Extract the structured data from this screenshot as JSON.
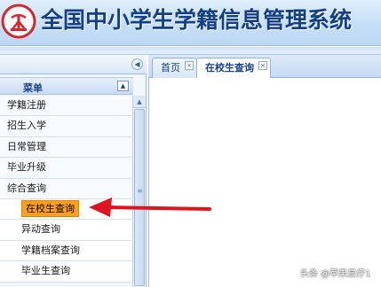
{
  "app": {
    "title": "全国中小学生学籍信息管理系统",
    "logo_icon": "school-logo-icon"
  },
  "sidebar": {
    "collapse_icon": "collapse-left-icon",
    "menu_header": "菜单",
    "menu_header_icon": "collapse-up-icon",
    "items": [
      {
        "label": "学籍注册",
        "level": 1
      },
      {
        "label": "招生入学",
        "level": 1
      },
      {
        "label": "日常管理",
        "level": 1
      },
      {
        "label": "毕业升级",
        "level": 1
      },
      {
        "label": "综合查询",
        "level": 1
      },
      {
        "label": "在校生查询",
        "level": 2,
        "active": true
      },
      {
        "label": "异动查询",
        "level": 2
      },
      {
        "label": "学籍档案查询",
        "level": 2
      },
      {
        "label": "毕业生查询",
        "level": 2
      }
    ]
  },
  "tabs": [
    {
      "label": "首页",
      "active": false
    },
    {
      "label": "在校生查询",
      "active": true
    }
  ],
  "annotation": {
    "type": "red-arrow",
    "color": "#e0141e",
    "target": "在校生查询"
  },
  "watermark": "头条 @苹果显仔1",
  "colors": {
    "header_bg": "#c6dff7",
    "title_text": "#123f88",
    "active_item_highlight": "#ff9f1c",
    "panel_border": "#99bbe8"
  }
}
